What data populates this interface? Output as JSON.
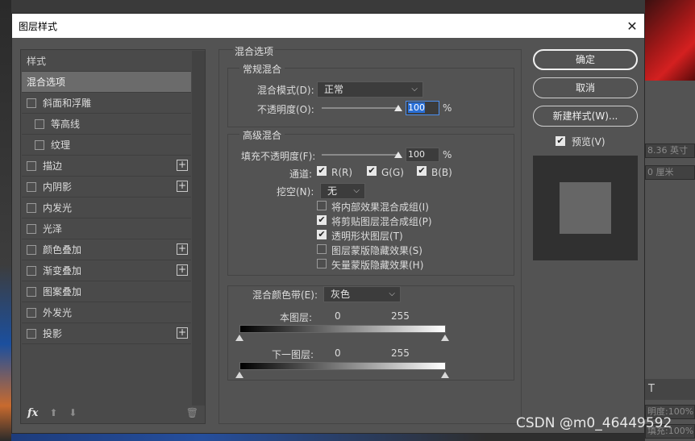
{
  "background": {
    "right_field_1": "8.36 英寸",
    "right_field_2": "0 厘米",
    "right_field_3": "明度:",
    "right_field_3b": "100%",
    "right_field_4": "填充:",
    "right_field_4b": "100%",
    "right_tools": "T",
    "watermark": "CSDN @m0_46449592"
  },
  "dialog": {
    "title": "图层样式",
    "close": "✕"
  },
  "left_panel": {
    "header": "样式",
    "selected": "混合选项",
    "items": [
      {
        "label": "斜面和浮雕",
        "sub": false,
        "plus": false
      },
      {
        "label": "等高线",
        "sub": true,
        "plus": false
      },
      {
        "label": "纹理",
        "sub": true,
        "plus": false
      },
      {
        "label": "描边",
        "sub": false,
        "plus": true
      },
      {
        "label": "内阴影",
        "sub": false,
        "plus": true
      },
      {
        "label": "内发光",
        "sub": false,
        "plus": false
      },
      {
        "label": "光泽",
        "sub": false,
        "plus": false
      },
      {
        "label": "颜色叠加",
        "sub": false,
        "plus": true
      },
      {
        "label": "渐变叠加",
        "sub": false,
        "plus": true
      },
      {
        "label": "图案叠加",
        "sub": false,
        "plus": false
      },
      {
        "label": "外发光",
        "sub": false,
        "plus": false
      },
      {
        "label": "投影",
        "sub": false,
        "plus": true
      }
    ],
    "footer_fx": "fx"
  },
  "blend": {
    "section_title": "混合选项",
    "general": {
      "title": "常规混合",
      "mode_label": "混合模式(D):",
      "mode_value": "正常",
      "opacity_label": "不透明度(O):",
      "opacity_value": "100",
      "opacity_unit": "%"
    },
    "advanced": {
      "title": "高级混合",
      "fill_label": "填充不透明度(F):",
      "fill_value": "100",
      "fill_unit": "%",
      "channels_label": "通道:",
      "channel_r": "R(R)",
      "channel_g": "G(G)",
      "channel_b": "B(B)",
      "knockout_label": "挖空(N):",
      "knockout_value": "无",
      "options": [
        {
          "label": "将内部效果混合成组(I)",
          "checked": false
        },
        {
          "label": "将剪贴图层混合成组(P)",
          "checked": true
        },
        {
          "label": "透明形状图层(T)",
          "checked": true
        },
        {
          "label": "图层蒙版隐藏效果(S)",
          "checked": false
        },
        {
          "label": "矢量蒙版隐藏效果(H)",
          "checked": false
        }
      ]
    },
    "blend_if": {
      "label": "混合颜色带(E):",
      "value": "灰色",
      "this_layer": "本图层:",
      "underlying": "下一图层:",
      "min": "0",
      "max": "255"
    }
  },
  "right": {
    "ok": "确定",
    "cancel": "取消",
    "new_style": "新建样式(W)...",
    "preview": "预览(V)",
    "preview_checked": true
  }
}
